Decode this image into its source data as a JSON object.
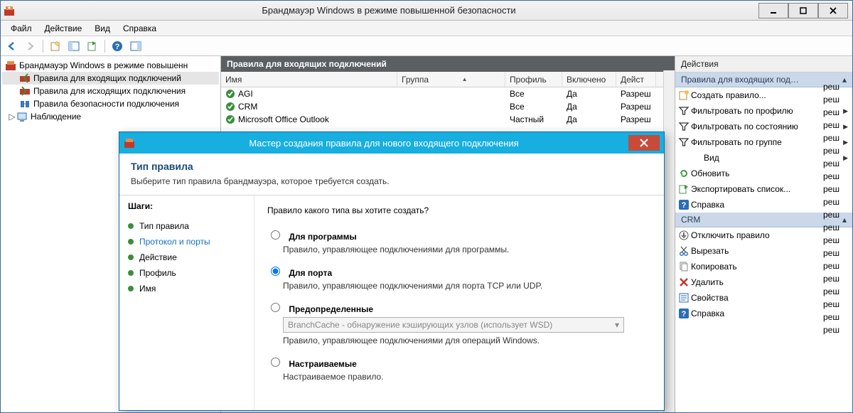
{
  "window": {
    "title": "Брандмауэр Windows в режиме повышенной безопасности"
  },
  "menu": {
    "file": "Файл",
    "action": "Действие",
    "view": "Вид",
    "help": "Справка"
  },
  "tree": {
    "root": "Брандмауэр Windows в режиме повышенн",
    "inbound": "Правила для входящих подключений",
    "outbound": "Правила для исходящих подключения",
    "connsec": "Правила безопасности подключения",
    "monitoring": "Наблюдение"
  },
  "center": {
    "title": "Правила для входящих подключений",
    "columns": {
      "name": "Имя",
      "group": "Группа",
      "profile": "Профиль",
      "enabled": "Включено",
      "action": "Дейст"
    },
    "rows": [
      {
        "name": "AGI",
        "group": "",
        "profile": "Все",
        "enabled": "Да",
        "action": "Разреш"
      },
      {
        "name": "CRM",
        "group": "",
        "profile": "Все",
        "enabled": "Да",
        "action": "Разреш"
      },
      {
        "name": "Microsoft Office Outlook",
        "group": "",
        "profile": "Частный",
        "enabled": "Да",
        "action": "Разреш"
      }
    ],
    "ghost_rows": [
      "реш",
      "реш",
      "реш",
      "реш",
      "реш",
      "реш",
      "реш",
      "реш",
      "реш",
      "реш",
      "реш",
      "реш",
      "реш",
      "реш",
      "реш",
      "реш",
      "реш",
      "реш",
      "реш",
      "реш"
    ]
  },
  "actions": {
    "pane_title": "Действия",
    "group1": "Правила для входящих под…",
    "items1": [
      {
        "icon": "new-rule-icon",
        "label": "Создать правило..."
      },
      {
        "icon": "filter-icon",
        "label": "Фильтровать по профилю",
        "sub": true
      },
      {
        "icon": "filter-icon",
        "label": "Фильтровать по состоянию",
        "sub": true
      },
      {
        "icon": "filter-icon",
        "label": "Фильтровать по группе",
        "sub": true
      },
      {
        "icon": "",
        "label": "Вид",
        "sub": true,
        "indent": true
      },
      {
        "icon": "refresh-icon",
        "label": "Обновить"
      },
      {
        "icon": "export-icon",
        "label": "Экспортировать список..."
      },
      {
        "icon": "help-icon",
        "label": "Справка"
      }
    ],
    "group2": "CRM",
    "items2": [
      {
        "icon": "disable-icon",
        "label": "Отключить правило"
      },
      {
        "icon": "cut-icon",
        "label": "Вырезать"
      },
      {
        "icon": "copy-icon",
        "label": "Копировать"
      },
      {
        "icon": "delete-icon",
        "label": "Удалить"
      },
      {
        "icon": "props-icon",
        "label": "Свойства"
      },
      {
        "icon": "help-icon",
        "label": "Справка"
      }
    ]
  },
  "wizard": {
    "title": "Мастер создания правила для нового входящего подключения",
    "head_title": "Тип правила",
    "head_desc": "Выберите тип правила брандмауэра, которое требуется создать.",
    "steps_title": "Шаги:",
    "steps": [
      "Тип правила",
      "Протокол и порты",
      "Действие",
      "Профиль",
      "Имя"
    ],
    "active_step_index": 1,
    "question": "Правило какого типа вы хотите создать?",
    "options": [
      {
        "label": "Для программы",
        "desc": "Правило, управляющее подключениями для программы.",
        "selected": false
      },
      {
        "label": "Для порта",
        "desc": "Правило, управляющее подключениями для порта TCP или UDP.",
        "selected": true
      },
      {
        "label": "Предопределенные",
        "desc": "Правило, управляющее подключениями для операций Windows.",
        "selected": false,
        "combo": "BranchCache - обнаружение кэширующих узлов (использует WSD)"
      },
      {
        "label": "Настраиваемые",
        "desc": "Настраиваемое правило.",
        "selected": false
      }
    ]
  }
}
